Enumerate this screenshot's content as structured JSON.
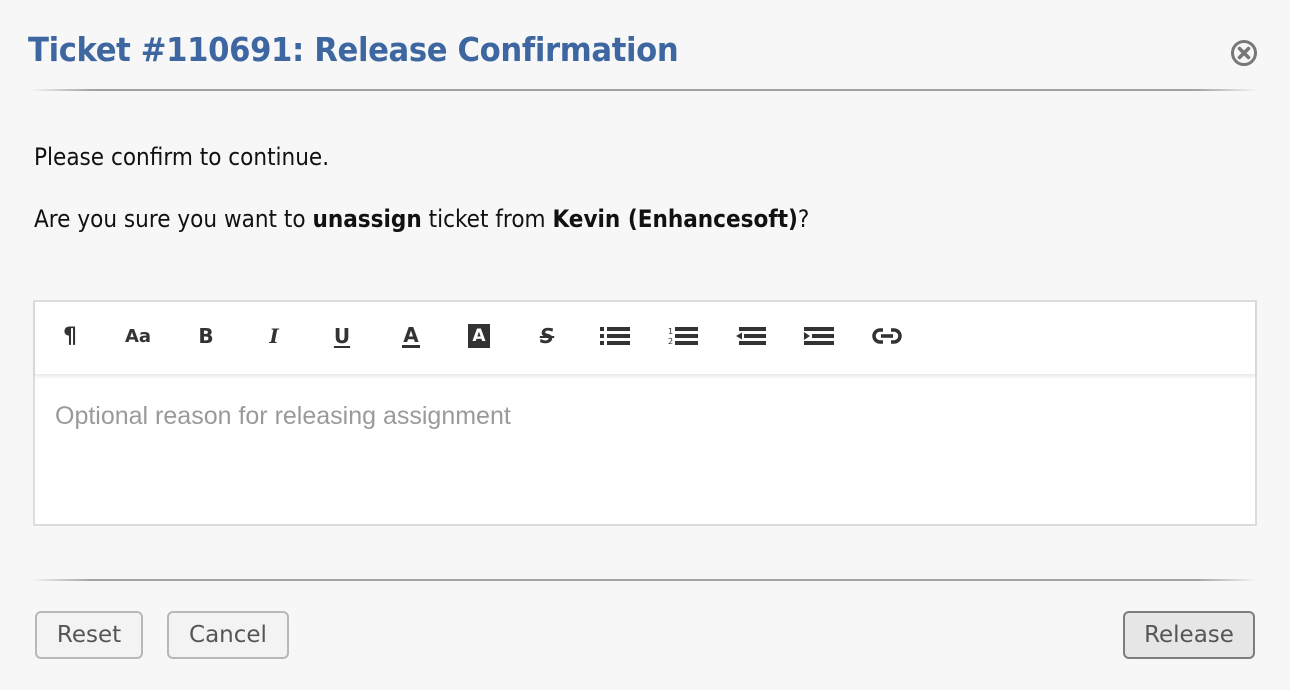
{
  "dialog": {
    "title": "Ticket #110691: Release Confirmation",
    "close_icon": "close-circle-icon"
  },
  "message": {
    "line1": "Please confirm to continue.",
    "line2_prefix": "Are you sure you want to ",
    "line2_action": "unassign",
    "line2_middle": " ticket from ",
    "line2_user": "Kevin (Enhancesoft)",
    "line2_suffix": "?"
  },
  "editor": {
    "toolbar": [
      {
        "name": "paragraph-format",
        "icon": "pilcrow-icon",
        "glyph": "¶"
      },
      {
        "name": "font-size",
        "icon": "font-size-icon",
        "glyph": "Aa"
      },
      {
        "name": "bold",
        "icon": "bold-icon",
        "glyph": "B"
      },
      {
        "name": "italic",
        "icon": "italic-icon",
        "glyph": "I"
      },
      {
        "name": "underline",
        "icon": "underline-icon",
        "glyph": "U"
      },
      {
        "name": "font-color",
        "icon": "font-color-icon",
        "glyph": "A"
      },
      {
        "name": "background-color",
        "icon": "highlight-color-icon",
        "glyph": "A"
      },
      {
        "name": "strikethrough",
        "icon": "strikethrough-icon",
        "glyph": "S"
      },
      {
        "name": "unordered-list",
        "icon": "bullet-list-icon",
        "glyph": ""
      },
      {
        "name": "ordered-list",
        "icon": "numbered-list-icon",
        "glyph": ""
      },
      {
        "name": "outdent",
        "icon": "outdent-icon",
        "glyph": ""
      },
      {
        "name": "indent",
        "icon": "indent-icon",
        "glyph": ""
      },
      {
        "name": "insert-link",
        "icon": "link-icon",
        "glyph": ""
      }
    ],
    "value": "",
    "placeholder": "Optional reason for releasing assignment"
  },
  "buttons": {
    "reset": "Reset",
    "cancel": "Cancel",
    "release": "Release"
  },
  "colors": {
    "title": "#3e67a1",
    "icon": "#333333"
  }
}
